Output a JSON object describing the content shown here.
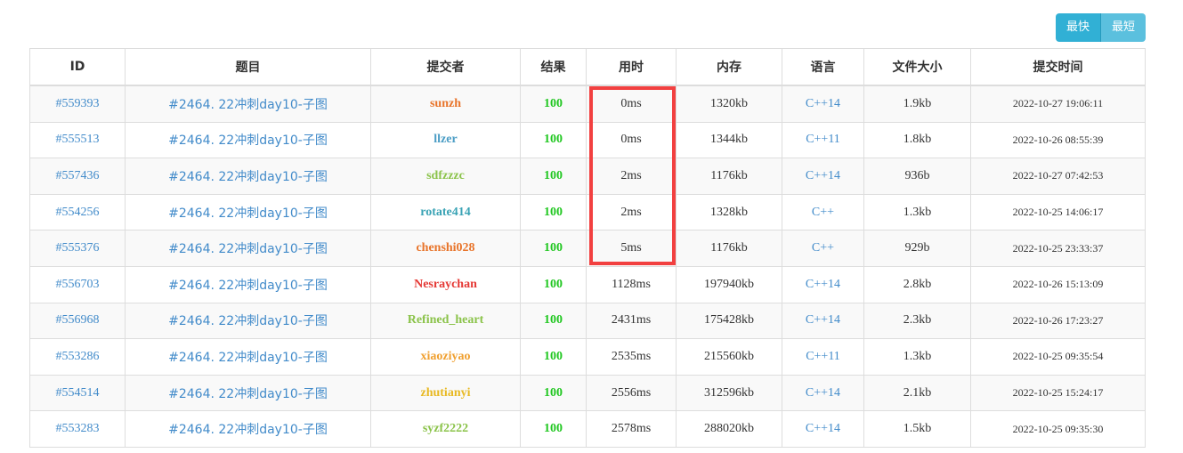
{
  "buttons": {
    "fastest": "最快",
    "shortest": "最短"
  },
  "table": {
    "headers": [
      "ID",
      "题目",
      "提交者",
      "结果",
      "用时",
      "内存",
      "语言",
      "文件大小",
      "提交时间"
    ],
    "rows": [
      {
        "id": "#559393",
        "problem": "#2464. 22冲刺day10-子图",
        "user": "sunzh",
        "user_color": "#e8742a",
        "score": "100",
        "time": "0ms",
        "memory": "1320kb",
        "lang": "C++14",
        "size": "1.9kb",
        "submit_time": "2022-10-27 19:06:11"
      },
      {
        "id": "#555513",
        "problem": "#2464. 22冲刺day10-子图",
        "user": "llzer",
        "user_color": "#4b9dc5",
        "score": "100",
        "time": "0ms",
        "memory": "1344kb",
        "lang": "C++11",
        "size": "1.8kb",
        "submit_time": "2022-10-26 08:55:39"
      },
      {
        "id": "#557436",
        "problem": "#2464. 22冲刺day10-子图",
        "user": "sdfzzzc",
        "user_color": "#8bc34a",
        "score": "100",
        "time": "2ms",
        "memory": "1176kb",
        "lang": "C++14",
        "size": "936b",
        "submit_time": "2022-10-27 07:42:53"
      },
      {
        "id": "#554256",
        "problem": "#2464. 22冲刺day10-子图",
        "user": "rotate414",
        "user_color": "#3aa3b5",
        "score": "100",
        "time": "2ms",
        "memory": "1328kb",
        "lang": "C++",
        "size": "1.3kb",
        "submit_time": "2022-10-25 14:06:17"
      },
      {
        "id": "#555376",
        "problem": "#2464. 22冲刺day10-子图",
        "user": "chenshi028",
        "user_color": "#e8742a",
        "score": "100",
        "time": "5ms",
        "memory": "1176kb",
        "lang": "C++",
        "size": "929b",
        "submit_time": "2022-10-25 23:33:37"
      },
      {
        "id": "#556703",
        "problem": "#2464. 22冲刺day10-子图",
        "user": "Nesraychan",
        "user_color": "#e53935",
        "score": "100",
        "time": "1128ms",
        "memory": "197940kb",
        "lang": "C++14",
        "size": "2.8kb",
        "submit_time": "2022-10-26 15:13:09"
      },
      {
        "id": "#556968",
        "problem": "#2464. 22冲刺day10-子图",
        "user": "Refined_heart",
        "user_color": "#8bc34a",
        "score": "100",
        "time": "2431ms",
        "memory": "175428kb",
        "lang": "C++14",
        "size": "2.3kb",
        "submit_time": "2022-10-26 17:23:27"
      },
      {
        "id": "#553286",
        "problem": "#2464. 22冲刺day10-子图",
        "user": "xiaoziyao",
        "user_color": "#f0a030",
        "score": "100",
        "time": "2535ms",
        "memory": "215560kb",
        "lang": "C++11",
        "size": "1.3kb",
        "submit_time": "2022-10-25 09:35:54"
      },
      {
        "id": "#554514",
        "problem": "#2464. 22冲刺day10-子图",
        "user": "zhutianyi",
        "user_color": "#e8b923",
        "score": "100",
        "time": "2556ms",
        "memory": "312596kb",
        "lang": "C++14",
        "size": "2.1kb",
        "submit_time": "2022-10-25 15:24:17"
      },
      {
        "id": "#553283",
        "problem": "#2464. 22冲刺day10-子图",
        "user": "syzf2222",
        "user_color": "#8bc34a",
        "score": "100",
        "time": "2578ms",
        "memory": "288020kb",
        "lang": "C++14",
        "size": "1.5kb",
        "submit_time": "2022-10-25 09:35:30"
      }
    ]
  },
  "colors": {
    "link": "#428bca",
    "score": "#21c721",
    "highlight": "#f24040",
    "button": "#31b0d5"
  }
}
